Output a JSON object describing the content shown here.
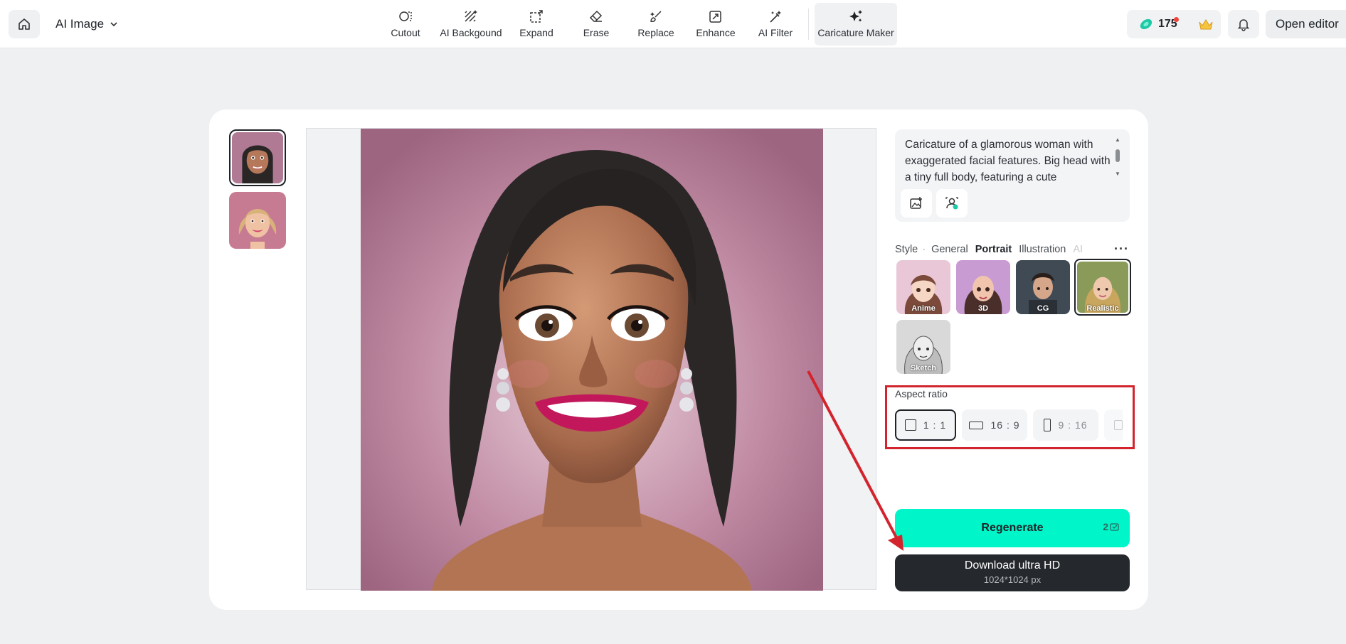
{
  "topbar": {
    "app_title": "AI Image",
    "tools": [
      {
        "label": "Cutout",
        "icon": "cutout-icon"
      },
      {
        "label": "AI Backgound",
        "icon": "ai-background-icon"
      },
      {
        "label": "Expand",
        "icon": "expand-icon"
      },
      {
        "label": "Erase",
        "icon": "eraser-icon"
      },
      {
        "label": "Replace",
        "icon": "brush-icon"
      },
      {
        "label": "Enhance",
        "icon": "enhance-icon"
      },
      {
        "label": "AI Filter",
        "icon": "magic-wand-icon"
      },
      {
        "label": "Caricature Maker",
        "icon": "sparkles-icon"
      }
    ],
    "credits": "175",
    "open_editor": "Open editor"
  },
  "prompt": {
    "text": "Caricature of a glamorous woman with exaggerated facial features. Big head with a tiny full body, featuring a cute"
  },
  "style_tabs": {
    "label": "Style",
    "items": [
      "General",
      "Portrait",
      "Illustration",
      "AI"
    ],
    "active": "Portrait"
  },
  "styles": [
    {
      "name": "Anime"
    },
    {
      "name": "3D"
    },
    {
      "name": "CG"
    },
    {
      "name": "Realistic",
      "selected": true
    },
    {
      "name": "Sketch"
    }
  ],
  "aspect": {
    "label": "Aspect ratio",
    "options": [
      "1 : 1",
      "16 : 9",
      "9 : 16"
    ],
    "selected": "1 : 1"
  },
  "actions": {
    "regenerate": "Regenerate",
    "regenerate_cost": "2",
    "download": "Download ultra HD",
    "download_size": "1024*1024 px"
  },
  "colors": {
    "accent": "#00f5c8",
    "dark": "#25282d",
    "annotation": "#d3242e"
  }
}
